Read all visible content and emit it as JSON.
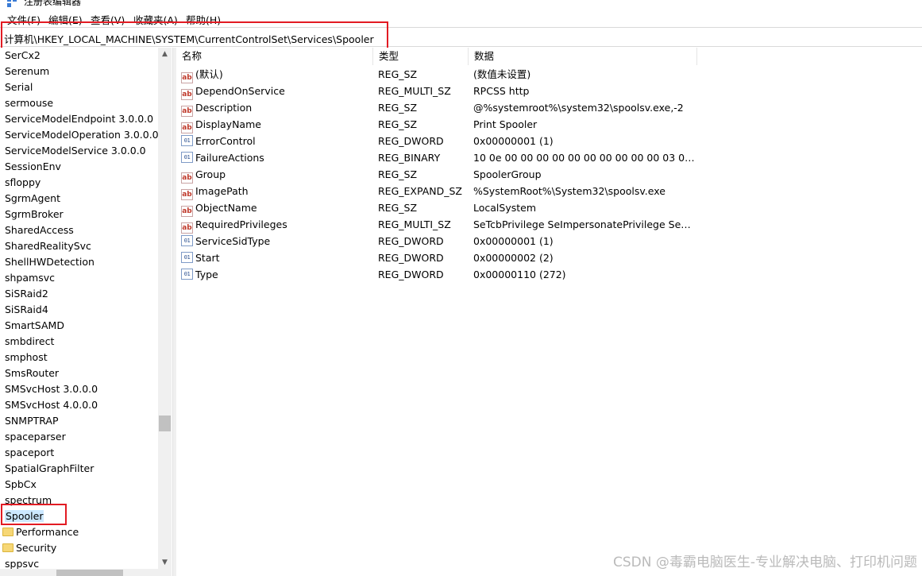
{
  "window": {
    "title": "注册表编辑器"
  },
  "menu": [
    "文件(F)",
    "编辑(E)",
    "查看(V)",
    "收藏夹(A)",
    "帮助(H)"
  ],
  "address": {
    "path": "计算机\\HKEY_LOCAL_MACHINE\\SYSTEM\\CurrentControlSet\\Services\\Spooler"
  },
  "tree": {
    "items": [
      {
        "label": "SerCx2"
      },
      {
        "label": "Serenum"
      },
      {
        "label": "Serial"
      },
      {
        "label": "sermouse"
      },
      {
        "label": "ServiceModelEndpoint 3.0.0.0"
      },
      {
        "label": "ServiceModelOperation 3.0.0.0"
      },
      {
        "label": "ServiceModelService 3.0.0.0"
      },
      {
        "label": "SessionEnv"
      },
      {
        "label": "sfloppy"
      },
      {
        "label": "SgrmAgent"
      },
      {
        "label": "SgrmBroker"
      },
      {
        "label": "SharedAccess"
      },
      {
        "label": "SharedRealitySvc"
      },
      {
        "label": "ShellHWDetection"
      },
      {
        "label": "shpamsvc"
      },
      {
        "label": "SiSRaid2"
      },
      {
        "label": "SiSRaid4"
      },
      {
        "label": "SmartSAMD"
      },
      {
        "label": "smbdirect"
      },
      {
        "label": "smphost"
      },
      {
        "label": "SmsRouter"
      },
      {
        "label": "SMSvcHost 3.0.0.0"
      },
      {
        "label": "SMSvcHost 4.0.0.0"
      },
      {
        "label": "SNMPTRAP"
      },
      {
        "label": "spaceparser"
      },
      {
        "label": "spaceport"
      },
      {
        "label": "SpatialGraphFilter"
      },
      {
        "label": "SpbCx"
      },
      {
        "label": "spectrum"
      },
      {
        "label": "Spooler",
        "selected": true
      },
      {
        "label": "Performance",
        "child": true
      },
      {
        "label": "Security",
        "child": true
      },
      {
        "label": "sppsvc"
      }
    ]
  },
  "values": {
    "headers": {
      "name": "名称",
      "type": "类型",
      "data": "数据"
    },
    "rows": [
      {
        "icon": "string-value-icon",
        "name": "(默认)",
        "type": "REG_SZ",
        "data": "(数值未设置)"
      },
      {
        "icon": "string-value-icon",
        "name": "DependOnService",
        "type": "REG_MULTI_SZ",
        "data": "RPCSS http"
      },
      {
        "icon": "string-value-icon",
        "name": "Description",
        "type": "REG_SZ",
        "data": "@%systemroot%\\system32\\spoolsv.exe,-2"
      },
      {
        "icon": "string-value-icon",
        "name": "DisplayName",
        "type": "REG_SZ",
        "data": "Print Spooler"
      },
      {
        "icon": "binary-value-icon",
        "name": "ErrorControl",
        "type": "REG_DWORD",
        "data": "0x00000001 (1)"
      },
      {
        "icon": "binary-value-icon",
        "name": "FailureActions",
        "type": "REG_BINARY",
        "data": "10 0e 00 00 00 00 00 00 00 00 00 00 03 00 00..."
      },
      {
        "icon": "string-value-icon",
        "name": "Group",
        "type": "REG_SZ",
        "data": "SpoolerGroup"
      },
      {
        "icon": "string-value-icon",
        "name": "ImagePath",
        "type": "REG_EXPAND_SZ",
        "data": "%SystemRoot%\\System32\\spoolsv.exe"
      },
      {
        "icon": "string-value-icon",
        "name": "ObjectName",
        "type": "REG_SZ",
        "data": "LocalSystem"
      },
      {
        "icon": "string-value-icon",
        "name": "RequiredPrivileges",
        "type": "REG_MULTI_SZ",
        "data": "SeTcbPrivilege SeImpersonatePrivilege SeAud..."
      },
      {
        "icon": "binary-value-icon",
        "name": "ServiceSidType",
        "type": "REG_DWORD",
        "data": "0x00000001 (1)"
      },
      {
        "icon": "binary-value-icon",
        "name": "Start",
        "type": "REG_DWORD",
        "data": "0x00000002 (2)"
      },
      {
        "icon": "binary-value-icon",
        "name": "Type",
        "type": "REG_DWORD",
        "data": "0x00000110 (272)"
      }
    ]
  },
  "icons": {
    "string": "ab",
    "binary": "011\n110"
  },
  "watermark": "CSDN @毒霸电脑医生-专业解决电脑、打印机问题",
  "colors": {
    "highlight_box": "#e21b23",
    "selection": "#cce8ff"
  }
}
